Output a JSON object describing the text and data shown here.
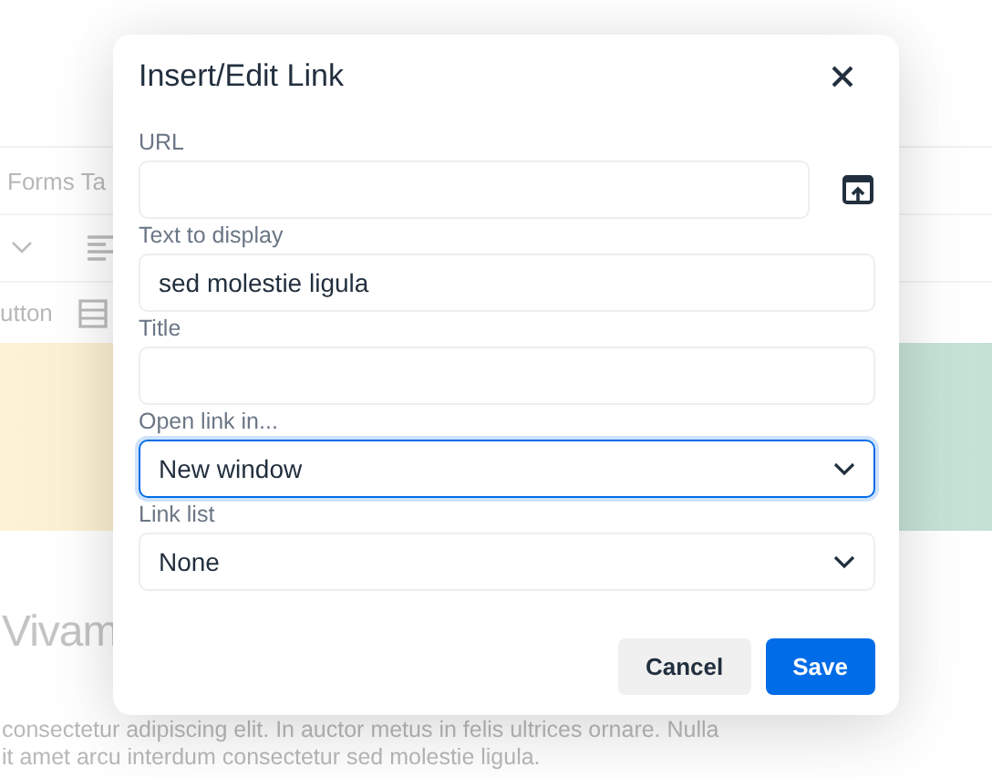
{
  "background": {
    "menu_text": "Forms Ta",
    "toolbar_text": "utton",
    "heading": "Vivam",
    "paragraph": [
      "consectetur adipiscing elit. In auctor metus in felis ultrices ornare. Nulla",
      "it amet arcu interdum consectetur sed molestie ligula."
    ]
  },
  "dialog": {
    "title": "Insert/Edit Link",
    "fields": [
      {
        "kind": "url",
        "label": "URL"
      },
      {
        "kind": "text",
        "label": "Text to display",
        "value": "sed molestie ligula"
      },
      {
        "kind": "text",
        "label": "Title"
      },
      {
        "kind": "select",
        "label": "Open link in...",
        "value": "New window",
        "focused": true
      },
      {
        "kind": "select",
        "label": "Link list",
        "value": "None",
        "focused": false
      }
    ],
    "buttons": [
      {
        "label": "Cancel",
        "primary": false
      },
      {
        "label": "Save",
        "primary": true
      }
    ]
  }
}
